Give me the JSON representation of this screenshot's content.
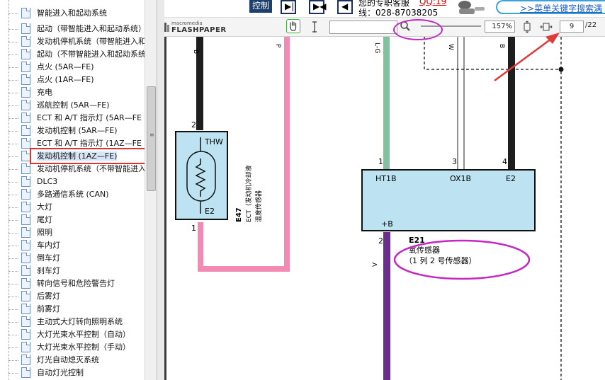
{
  "tree": {
    "items": [
      {
        "label": "智能进入和起动系统"
      },
      {
        "label": "起动（带智能进入和起动系统）"
      },
      {
        "label": "发动机停机系统（带智能进入和"
      },
      {
        "label": "起动（不带智能进入和起动系统"
      },
      {
        "label": "点火 (5AR—FE)"
      },
      {
        "label": "点火 (1AR—FE)"
      },
      {
        "label": "充电"
      },
      {
        "label": "巡航控制 (5AR—FE)"
      },
      {
        "label": "ECT 和 A/T 指示灯 (5AR—FE"
      },
      {
        "label": "发动机控制 (5AR—FE)"
      },
      {
        "label": "ECT 和 A/T 指示灯 (1AZ—FE"
      },
      {
        "label": "发动机控制 (1AZ—FE)"
      },
      {
        "label": "发动机停机系统（不带智能进入"
      },
      {
        "label": "DLC3"
      },
      {
        "label": "多路通信系统 (CAN)"
      },
      {
        "label": "大灯"
      },
      {
        "label": "尾灯"
      },
      {
        "label": "照明"
      },
      {
        "label": "车内灯"
      },
      {
        "label": "倒车灯"
      },
      {
        "label": "刹车灯"
      },
      {
        "label": "转向信号和危险警告灯"
      },
      {
        "label": "后雾灯"
      },
      {
        "label": "前雾灯"
      },
      {
        "label": "主动式大灯转向照明系统"
      },
      {
        "label": "大灯光束水平控制（自动）"
      },
      {
        "label": "大灯光束水平控制（手动）"
      },
      {
        "label": "灯光自动熄灭系统"
      },
      {
        "label": "自动灯光控制"
      }
    ],
    "selected_index": 11
  },
  "banner": {
    "control_label": "控制",
    "support_text": "您的专职客服",
    "qq_link": "QQ:19",
    "phone_text": "线：028-87038205",
    "search_link": ">>菜单关键字搜索满"
  },
  "toolbar": {
    "logo_line1": "macromedia",
    "logo_line2": "FLASHPAPER",
    "search_value": "",
    "zoom_value": "157%",
    "zoom_level_percent": 60,
    "page_current": "9",
    "page_total": "/22"
  },
  "diagram": {
    "left_connector": {
      "pin_top": "2",
      "pin_bottom": "1",
      "label_top": "THW",
      "label_bottom": "E2",
      "code": "E47",
      "name": "ECT（发动机冷却液",
      "name2": "温度传感器"
    },
    "wire_tags": {
      "black_left": "B",
      "pink": "P",
      "green": "L-G",
      "white": "W",
      "black_right": "B",
      "violet": "V"
    },
    "sensor": {
      "pin_1": "1",
      "pin_3": "3",
      "pin_4": "4",
      "pin_2": "2",
      "label_ht": "HT1B",
      "label_ox": "OX1B",
      "label_e2": "E2",
      "label_b": "+B",
      "code": "E21",
      "name": "氧传感器",
      "note": "（1 列 2 号传感器）"
    }
  },
  "colors": {
    "wire_black": "#1e1e1e",
    "wire_pink": "#f28ab4",
    "wire_green": "#7fc29b",
    "wire_violet": "#6a2f8a",
    "component_fill": "#bde3f2",
    "highlight_red": "#e03030",
    "highlight_magenta": "#c426c4"
  }
}
